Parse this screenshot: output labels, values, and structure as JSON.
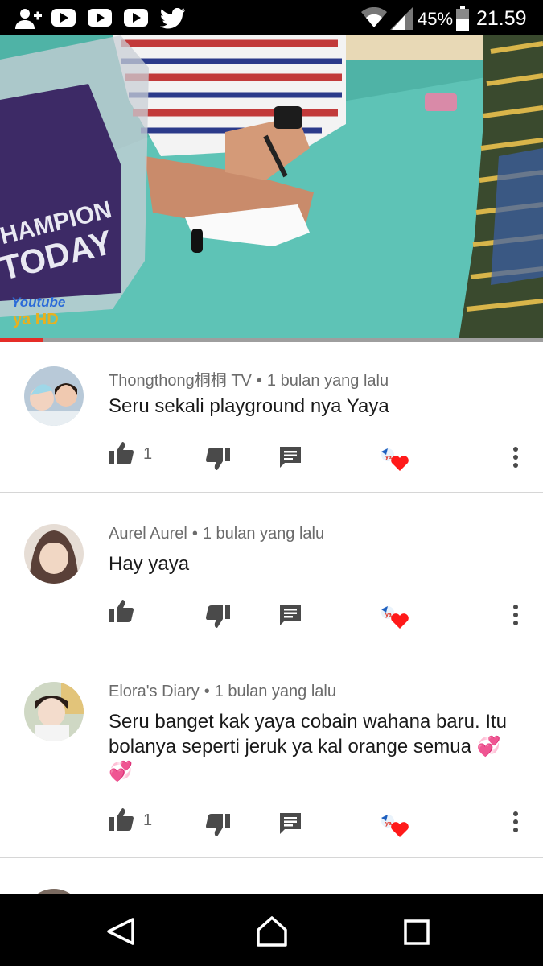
{
  "status_bar": {
    "battery_percent": "45%",
    "time": "21.59",
    "icons": [
      "add-person-icon",
      "youtube-icon",
      "youtube-icon",
      "youtube-icon",
      "twitter-icon",
      "wifi-icon",
      "signal-icon",
      "battery-icon"
    ]
  },
  "video": {
    "watermark_line1": "Youtube",
    "watermark_line2": "ya HD",
    "shirt_text": "CHAMPION TODAY",
    "progress_fraction": 0.08
  },
  "comments": [
    {
      "author": "Thongthong桐桐 TV",
      "separator": "•",
      "time": "1 bulan yang lalu",
      "text": "Seru sekali playground nya Yaya",
      "likes": "1"
    },
    {
      "author": "Aurel Aurel",
      "separator": "•",
      "time": "1 bulan yang lalu",
      "text": "Hay yaya",
      "likes": ""
    },
    {
      "author": "Elora's Diary",
      "separator": "•",
      "time": "1 bulan yang lalu",
      "text": "Seru banget kak yaya cobain wahana baru. Itu bolanya seperti jeruk ya kal orange semua 💞💞",
      "likes": "1"
    }
  ],
  "nav_bar": {
    "icons": [
      "back-icon",
      "home-icon",
      "recents-icon"
    ]
  },
  "colors": {
    "accent": "#e52d27",
    "heart": "#ff1a1a",
    "text": "#1a1a1a",
    "meta": "#6b6b6b",
    "icon": "#4a4a4a"
  }
}
